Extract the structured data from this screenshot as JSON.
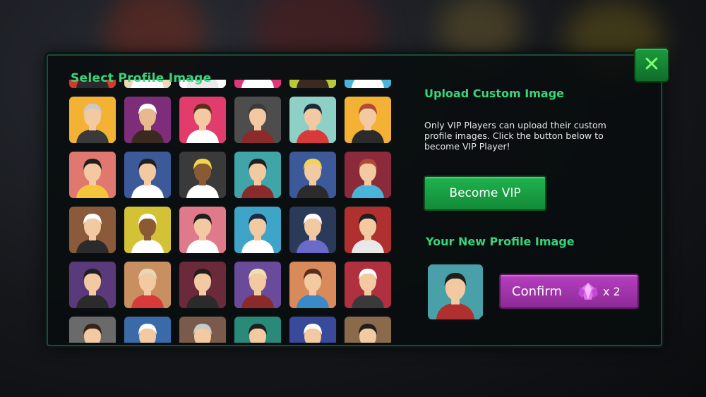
{
  "dialog": {
    "title": "Select Profile Image",
    "close_symbol": "✕"
  },
  "upload": {
    "title": "Upload Custom Image",
    "description": "Only VIP Players can upload their custom profile images. Click the button below to become VIP Player!",
    "vip_button": "Become VIP"
  },
  "new_profile": {
    "title": "Your New Profile Image",
    "confirm_label": "Confirm",
    "gem_icon": "purple-gem-icon",
    "cost": "x 2"
  },
  "avatars": [
    {
      "bg": "#d13a2c",
      "skin": "#f2c9a0",
      "hair": "#3a2418",
      "shirt": "#2b2b2b"
    },
    {
      "bg": "#e9d9b9",
      "skin": "#f2c9a0",
      "hair": "#3a2418",
      "shirt": "#ffffff"
    },
    {
      "bg": "#ffffff",
      "skin": "#f2c9a0",
      "hair": "#2fa84a",
      "shirt": "#eaeaea"
    },
    {
      "bg": "#e0367a",
      "skin": "#f2c9a0",
      "hair": "#3a2418",
      "shirt": "#ffffff"
    },
    {
      "bg": "#b8c935",
      "skin": "#f2c9a0",
      "hair": "#6b4a2a",
      "shirt": "#3a2a20"
    },
    {
      "bg": "#4ab3d8",
      "skin": "#f2c9a0",
      "hair": "#3a2418",
      "shirt": "#ffffff"
    },
    {
      "bg": "#f3b233",
      "skin": "#f2c9a0",
      "hair": "#c9c9c9",
      "shirt": "#3a3a3a"
    },
    {
      "bg": "#7d2d7a",
      "skin": "#e8b98e",
      "hair": "#ffffff",
      "shirt": "#3a2a20"
    },
    {
      "bg": "#e23c6c",
      "skin": "#f2c9a0",
      "hair": "#5a2e1c",
      "shirt": "#ffffff"
    },
    {
      "bg": "#4d4d4d",
      "skin": "#f2c9a0",
      "hair": "#3a3a3a",
      "shirt": "#8a2a2a"
    },
    {
      "bg": "#8ecfc6",
      "skin": "#f2c9a0",
      "hair": "#1c2a38",
      "shirt": "#d83a3a"
    },
    {
      "bg": "#f3b233",
      "skin": "#f2c9a0",
      "hair": "#b04a38",
      "shirt": "#2b2b2b"
    },
    {
      "bg": "#e07870",
      "skin": "#f2c9a0",
      "hair": "#1f1f1f",
      "shirt": "#f3c53a"
    },
    {
      "bg": "#3c5a9a",
      "skin": "#f2c9a0",
      "hair": "#1f1f1f",
      "shirt": "#ffffff"
    },
    {
      "bg": "#3a3a3a",
      "skin": "#8a5a34",
      "hair": "#f3d34a",
      "shirt": "#ffffff"
    },
    {
      "bg": "#3fa5a8",
      "skin": "#f2c9a0",
      "hair": "#1f1f1f",
      "shirt": "#8a2a2a"
    },
    {
      "bg": "#3c5a9a",
      "skin": "#f2c9a0",
      "hair": "#f3d34a",
      "shirt": "#2b2b2b"
    },
    {
      "bg": "#8a2a3a",
      "skin": "#f2c9a0",
      "hair": "#b04a38",
      "shirt": "#4ab3d8"
    },
    {
      "bg": "#8a5a3a",
      "skin": "#f2c9a0",
      "hair": "#ffffff",
      "shirt": "#2b2b2b"
    },
    {
      "bg": "#d3c235",
      "skin": "#8a5a34",
      "hair": "#ffffff",
      "shirt": "#ffffff"
    },
    {
      "bg": "#e07a8a",
      "skin": "#f2c9a0",
      "hair": "#1f1f1f",
      "shirt": "#ffffff"
    },
    {
      "bg": "#3fa5c8",
      "skin": "#f2c9a0",
      "hair": "#1c2a48",
      "shirt": "#ffffff"
    },
    {
      "bg": "#2b3a58",
      "skin": "#f2c9a0",
      "hair": "#ffffff",
      "shirt": "#6a6ac8"
    },
    {
      "bg": "#b03030",
      "skin": "#f2c9a0",
      "hair": "#1f1f1f",
      "shirt": "#e8e8e8"
    },
    {
      "bg": "#5a3a7a",
      "skin": "#f2c9a0",
      "hair": "#1f1f1f",
      "shirt": "#2b2b2b"
    },
    {
      "bg": "#c89060",
      "skin": "#f2c9a0",
      "hair": "#e8d8b8",
      "shirt": "#d83a3a"
    },
    {
      "bg": "#6a2a3a",
      "skin": "#f2c9a0",
      "hair": "#1f1f1f",
      "shirt": "#2b2b2b"
    },
    {
      "bg": "#6a4a9a",
      "skin": "#f2c9a0",
      "hair": "#f0e0b0",
      "shirt": "#8a2a2a"
    },
    {
      "bg": "#d88a5a",
      "skin": "#f2c9a0",
      "hair": "#5a2e1c",
      "shirt": "#3a8ac8"
    },
    {
      "bg": "#b03040",
      "skin": "#f2c9a0",
      "hair": "#ffffff",
      "shirt": "#3a3a3a"
    },
    {
      "bg": "#6a6a6a",
      "skin": "#f2c9a0",
      "hair": "#3a2418",
      "shirt": "#2b2b2b"
    },
    {
      "bg": "#3a6aa8",
      "skin": "#f2c9a0",
      "hair": "#ffffff",
      "shirt": "#2b2b2b"
    },
    {
      "bg": "#7a5a4a",
      "skin": "#f2c9a0",
      "hair": "#c9c9c9",
      "shirt": "#2b2b2b"
    },
    {
      "bg": "#2a8a7a",
      "skin": "#f2c9a0",
      "hair": "#1f1f1f",
      "shirt": "#2b2b2b"
    },
    {
      "bg": "#3a4a9a",
      "skin": "#f2c9a0",
      "hair": "#ffffff",
      "shirt": "#2b2b2b"
    },
    {
      "bg": "#8a6a4a",
      "skin": "#f2c9a0",
      "hair": "#1f1f1f",
      "shirt": "#2b2b2b"
    }
  ],
  "selected_avatar": {
    "bg": "#4aa0a8",
    "skin": "#f2c9a0",
    "hair": "#1f1f1f",
    "shirt": "#b03030"
  }
}
